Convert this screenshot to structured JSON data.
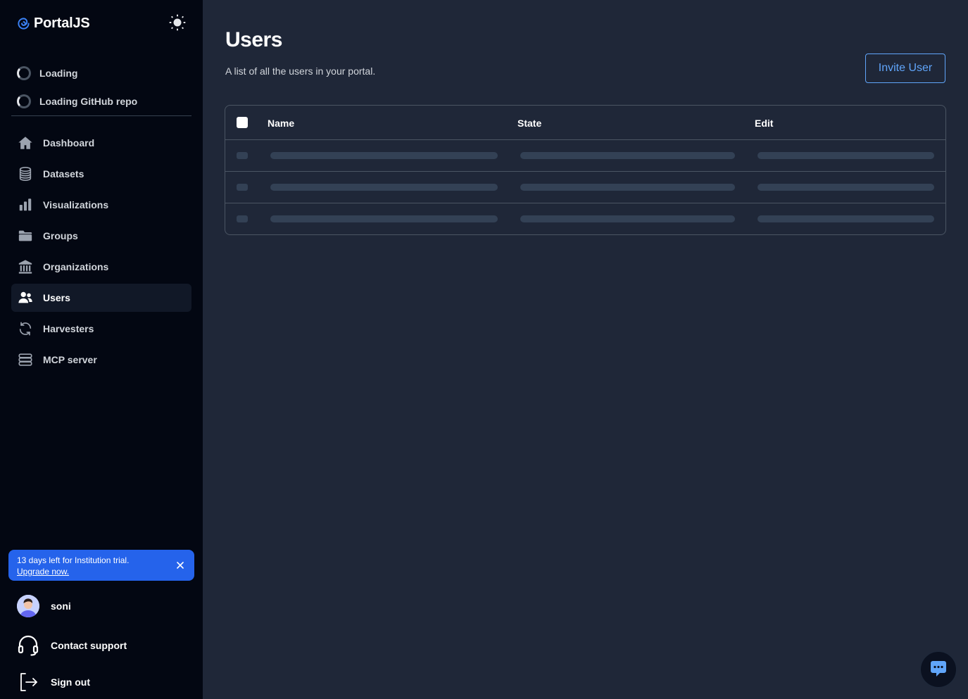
{
  "brand": {
    "name": "PortalJS"
  },
  "loading": [
    {
      "label": "Loading"
    },
    {
      "label": "Loading GitHub repo"
    }
  ],
  "nav": [
    {
      "label": "Dashboard",
      "icon": "home-icon"
    },
    {
      "label": "Datasets",
      "icon": "database-icon"
    },
    {
      "label": "Visualizations",
      "icon": "bar-chart-icon"
    },
    {
      "label": "Groups",
      "icon": "folder-icon"
    },
    {
      "label": "Organizations",
      "icon": "building-icon"
    },
    {
      "label": "Users",
      "icon": "users-icon",
      "active": true
    },
    {
      "label": "Harvesters",
      "icon": "refresh-icon"
    },
    {
      "label": "MCP server",
      "icon": "server-icon"
    }
  ],
  "trial": {
    "message": "13 days left for Institution trial.",
    "link": "Upgrade now."
  },
  "user": {
    "name": "soni"
  },
  "footer": {
    "support": "Contact support",
    "signout": "Sign out"
  },
  "page": {
    "title": "Users",
    "subtitle": "A list of all the users in your portal.",
    "invite_label": "Invite User"
  },
  "table": {
    "columns": [
      "Name",
      "State",
      "Edit"
    ],
    "skeleton_rows": 3
  },
  "colors": {
    "sidebar_bg": "#030712",
    "main_bg": "#1f2738",
    "accent": "#2563eb",
    "link": "#60a5fa"
  }
}
